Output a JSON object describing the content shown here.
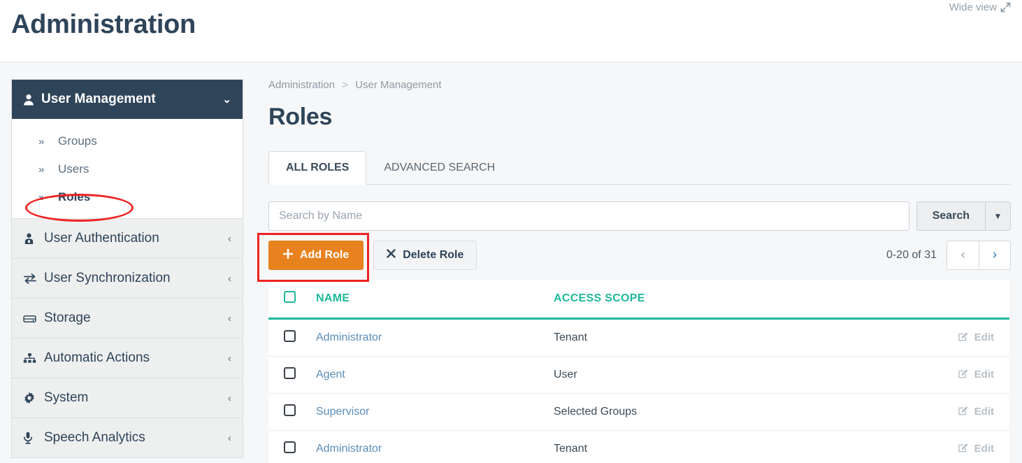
{
  "header": {
    "title": "Administration",
    "wide_view_label": "Wide view",
    "wide_view_icon": "expand-arrows-icon"
  },
  "sidebar": {
    "header": {
      "label": "User Management",
      "icon": "user-icon",
      "chevron": "chevron-down-icon",
      "expanded": true
    },
    "sub_items": [
      {
        "label": "Groups",
        "icon": "angle-double-right-icon",
        "active": false
      },
      {
        "label": "Users",
        "icon": "angle-double-right-icon",
        "active": false
      },
      {
        "label": "Roles",
        "icon": "angle-double-right-icon",
        "active": true
      }
    ],
    "groups": [
      {
        "label": "User Authentication",
        "icon": "user-lock-icon",
        "chevron": "chevron-left-icon"
      },
      {
        "label": "User Synchronization",
        "icon": "exchange-arrows-icon",
        "chevron": "chevron-left-icon"
      },
      {
        "label": "Storage",
        "icon": "hdd-icon",
        "chevron": "chevron-left-icon"
      },
      {
        "label": "Automatic Actions",
        "icon": "sitemap-icon",
        "chevron": "chevron-left-icon"
      },
      {
        "label": "System",
        "icon": "gear-icon",
        "chevron": "chevron-left-icon"
      },
      {
        "label": "Speech Analytics",
        "icon": "microphone-icon",
        "chevron": "chevron-left-icon"
      }
    ]
  },
  "main": {
    "breadcrumb": {
      "root": "Administration",
      "separator": ">",
      "current": "User Management"
    },
    "section_title": "Roles",
    "tabs": [
      {
        "label": "ALL ROLES",
        "active": true
      },
      {
        "label": "ADVANCED SEARCH",
        "active": false
      }
    ],
    "search": {
      "placeholder": "Search by Name",
      "value": "",
      "button_label": "Search",
      "caret_icon": "caret-down-icon"
    },
    "actions": {
      "add_label": "Add Role",
      "add_icon": "plus-icon",
      "delete_label": "Delete Role",
      "delete_icon": "times-icon"
    },
    "pagination": {
      "count_label": "0-20 of 31",
      "prev_icon": "chevron-left-icon",
      "next_icon": "chevron-right-icon"
    },
    "table": {
      "columns": [
        "NAME",
        "ACCESS SCOPE"
      ],
      "select_all_checkbox": "unchecked",
      "edit_label": "Edit",
      "edit_icon": "pencil-square-icon",
      "rows": [
        {
          "checked": false,
          "name": "Administrator",
          "access_scope": "Tenant"
        },
        {
          "checked": false,
          "name": "Agent",
          "access_scope": "User"
        },
        {
          "checked": false,
          "name": "Supervisor",
          "access_scope": "Selected Groups"
        },
        {
          "checked": false,
          "name": "Administrator",
          "access_scope": "Tenant"
        }
      ]
    }
  },
  "annotations": {
    "color": "#ee2222",
    "ellipse_target": "Roles",
    "rect_target": "Add Role"
  },
  "colors": {
    "sidebar_header_bg": "#2e4459",
    "accent_orange": "#e8821e",
    "accent_teal": "#1fb89a",
    "link_blue": "#5b8db8",
    "page_bg": "#f6f7f8"
  }
}
